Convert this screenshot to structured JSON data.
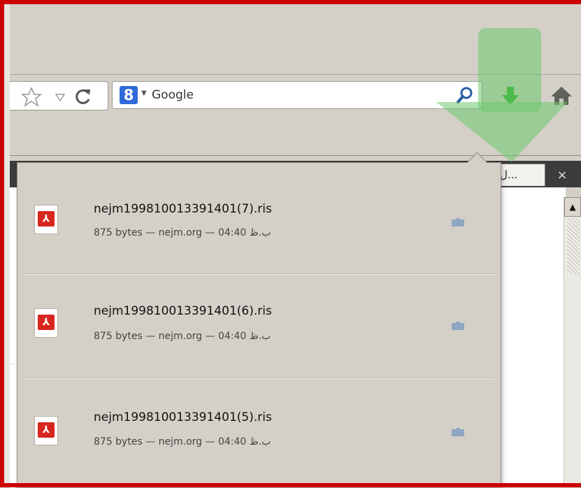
{
  "search": {
    "engine": "Google",
    "engine_badge": "8"
  },
  "tab": {
    "title": "ل...",
    "close": "×"
  },
  "downloads": [
    {
      "filename": "nejm199810013391401(7).ris",
      "meta": "875 bytes — nejm.org — 04:40 ب.ظ"
    },
    {
      "filename": "nejm199810013391401(6).ris",
      "meta": "875 bytes — nejm.org — 04:40 ب.ظ"
    },
    {
      "filename": "nejm199810013391401(5).ris",
      "meta": "875 bytes — nejm.org — 04:40 ب.ظ"
    }
  ],
  "icons": {
    "bookmark": "star-icon",
    "history_dropdown": "triangle-down-icon",
    "reload": "reload-icon",
    "search": "magnifier-icon",
    "download": "download-arrow-icon",
    "home": "home-icon",
    "file": "pdf-file-icon",
    "folder": "folder-icon"
  },
  "colors": {
    "window_border": "#cc0000",
    "chrome": "#d4d0c8",
    "download_green": "#22aa22",
    "pdf_red": "#d7261e",
    "google_blue": "#2f6bd8"
  }
}
